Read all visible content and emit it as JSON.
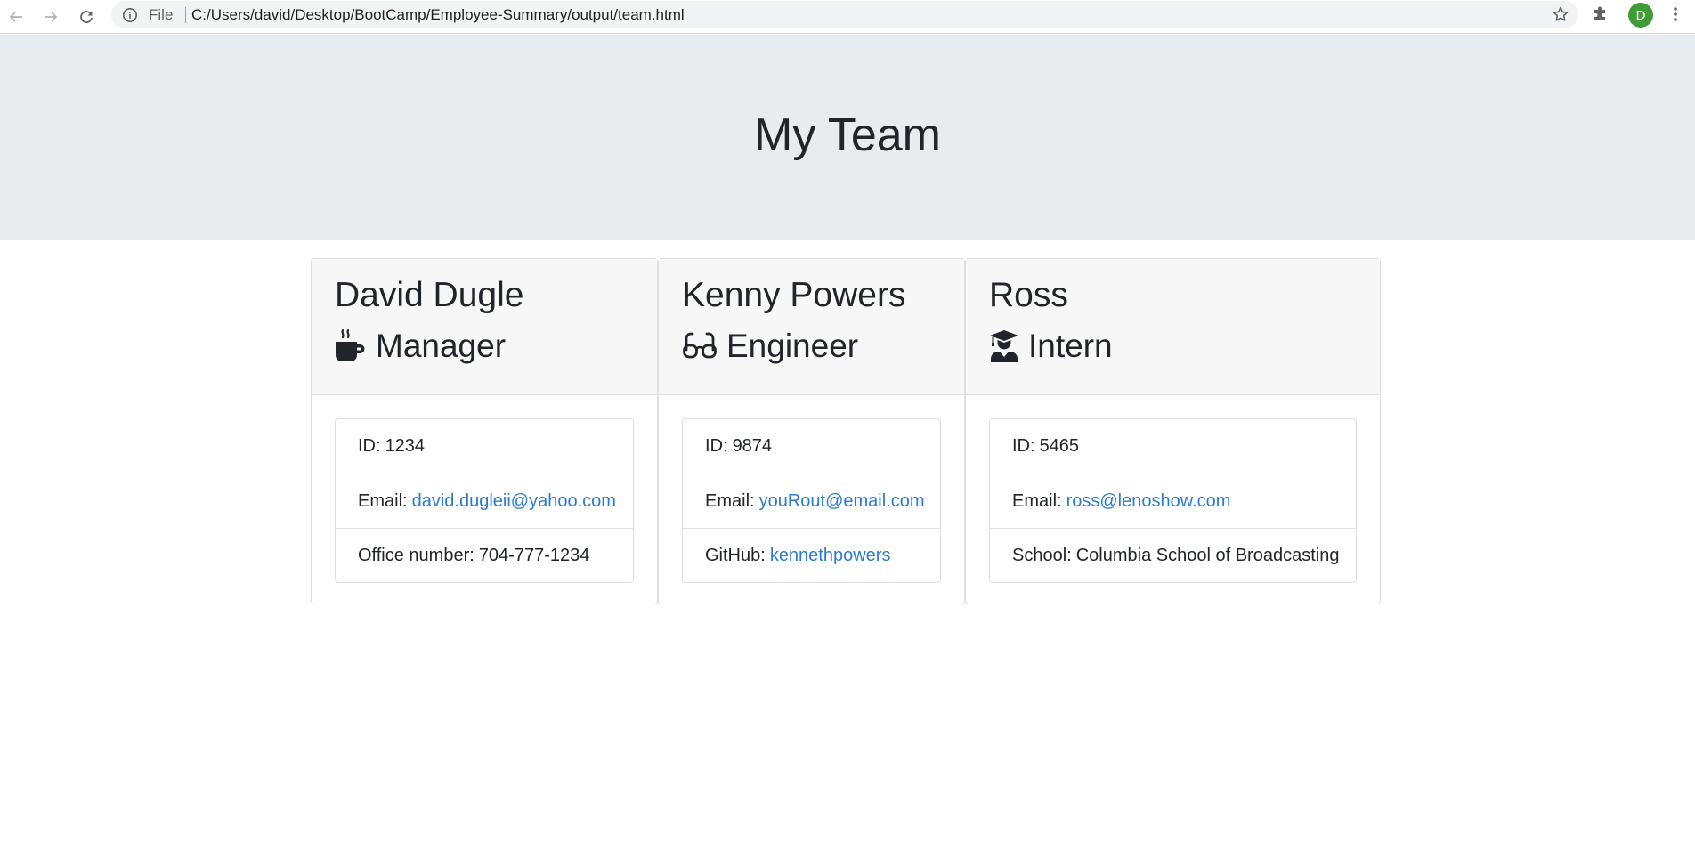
{
  "browser": {
    "scheme_label": "File",
    "url": "C:/Users/david/Desktop/BootCamp/Employee-Summary/output/team.html",
    "profile_initial": "D"
  },
  "page": {
    "title": "My Team"
  },
  "employees": [
    {
      "name": "David Dugle",
      "role": "Manager",
      "role_icon": "mug-hot-icon",
      "id_label": "ID:",
      "id": "1234",
      "email_label": "Email:",
      "email": "david.dugleii@yahoo.com",
      "extra_label": "Office number:",
      "extra_value": "704-777-1234"
    },
    {
      "name": "Kenny Powers",
      "role": "Engineer",
      "role_icon": "glasses-icon",
      "id_label": "ID:",
      "id": "9874",
      "email_label": "Email:",
      "email": "youRout@email.com",
      "extra_label": "GitHub:",
      "extra_value": "kennethpowers"
    },
    {
      "name": "Ross",
      "role": "Intern",
      "role_icon": "user-graduate-icon",
      "id_label": "ID:",
      "id": "5465",
      "email_label": "Email:",
      "email": "ross@lenoshow.com",
      "extra_label": "School:",
      "extra_value": "Columbia School of Broadcasting"
    }
  ],
  "colors": {
    "link": "#2a7bd4",
    "jumbotron_bg": "#e9ecef",
    "card_header_bg": "#f7f7f7"
  }
}
